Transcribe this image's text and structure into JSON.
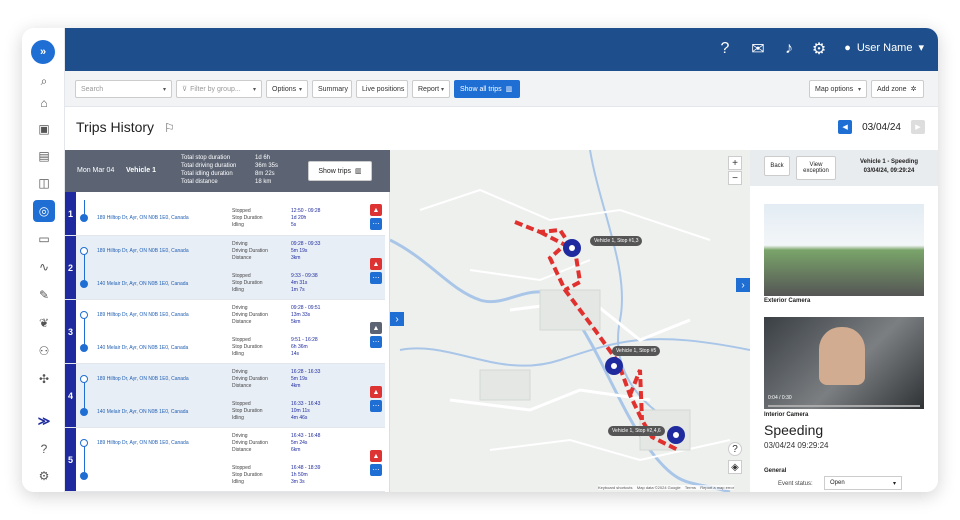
{
  "topbar": {
    "user_name": "User Name"
  },
  "toolbar": {
    "search_placeholder": "Search",
    "filter_placeholder": "Filter by group...",
    "options_label": "Options",
    "summary_label": "Summary",
    "live_label": "Live positions",
    "report_label": "Report",
    "show_all_label": "Show all trips",
    "map_options_label": "Map options",
    "add_zone_label": "Add zone"
  },
  "page": {
    "title": "Trips History",
    "date": "03/04/24"
  },
  "summary": {
    "date": "Mon Mar 04",
    "vehicle": "Vehicle 1",
    "labels": "Total stop duration\nTotal driving duration\nTotal idling duration\nTotal distance",
    "values": "1d 6h\n36m 35s\n8m 22s\n18 km",
    "show_trips_label": "Show trips"
  },
  "trips": [
    {
      "num": "1",
      "start": "189 Hilltop Dr, Ayr, ON N0B 1E0, Canada",
      "end": "",
      "l1": "Stopped\nStop Duration\nIdling",
      "v1": "12:50 - 09:28\n1d 20h\n5s",
      "l2": "",
      "v2": ""
    },
    {
      "num": "2",
      "start": "189 Hilltop Dr, Ayr, ON N0B 1E0, Canada",
      "end": "140 Melair Dr, Ayr, ON N0B 1E0, Canada",
      "l1": "Driving\nDriving Duration\nDistance",
      "v1": "09:28 - 09:33\n5m 19s\n3km",
      "l2": "Stopped\nStop Duration\nIdling",
      "v2": "9:33 - 09:38\n4m 31s\n1m 7s"
    },
    {
      "num": "3",
      "start": "189 Hilltop Dr, Ayr, ON N0B 1E0, Canada",
      "end": "140 Melair Dr, Ayr, ON N0B 1E0, Canada",
      "l1": "Driving\nDriving Duration\nDistance",
      "v1": "09:28 - 09:51\n13m 33s\n5km",
      "l2": "Stopped\nStop Duration\nIdling",
      "v2": "9:51 - 16:28\n6h 36m\n14s"
    },
    {
      "num": "4",
      "start": "189 Hilltop Dr, Ayr, ON N0B 1E0, Canada",
      "end": "140 Melair Dr, Ayr, ON N0B 1E0, Canada",
      "l1": "Driving\nDriving Duration\nDistance",
      "v1": "16:28 - 16:33\n5m 19s\n4km",
      "l2": "Stopped\nStop Duration\nIdling",
      "v2": "16:33 - 16:43\n10m 11s\n4m 46s"
    },
    {
      "num": "5",
      "start": "189 Hilltop Dr, Ayr, ON N0B 1E0, Canada",
      "end": "",
      "l1": "Driving\nDriving Duration\nDistance",
      "v1": "16:43 - 16:48\n5m 24s\n6km",
      "l2": "Stopped\nStop Duration\nIdling",
      "v2": "16:48 - 18:39\n1h 50m\n3m 3s"
    }
  ],
  "map": {
    "stop1": "Vehicle 1, Stop #1,3",
    "stop5": "Vehicle 1, Stop #5",
    "stop246": "Vehicle 1, Stop #2,4,6",
    "footer": "Keyboard shortcuts    Map data ©2024 Google    Terms    Report a map error"
  },
  "event": {
    "back_label": "Back",
    "view_label": "View exception",
    "header": "Vehicle 1 - Speeding\n03/04/24, 09:29:24",
    "exterior_label": "Exterior Camera",
    "interior_label": "Interior Camera",
    "video_time": "0:04 / 0:30",
    "type": "Speeding",
    "datetime": "03/04/24 09:29:24",
    "general_label": "General",
    "status_label": "Event status:",
    "status_value": "Open"
  }
}
